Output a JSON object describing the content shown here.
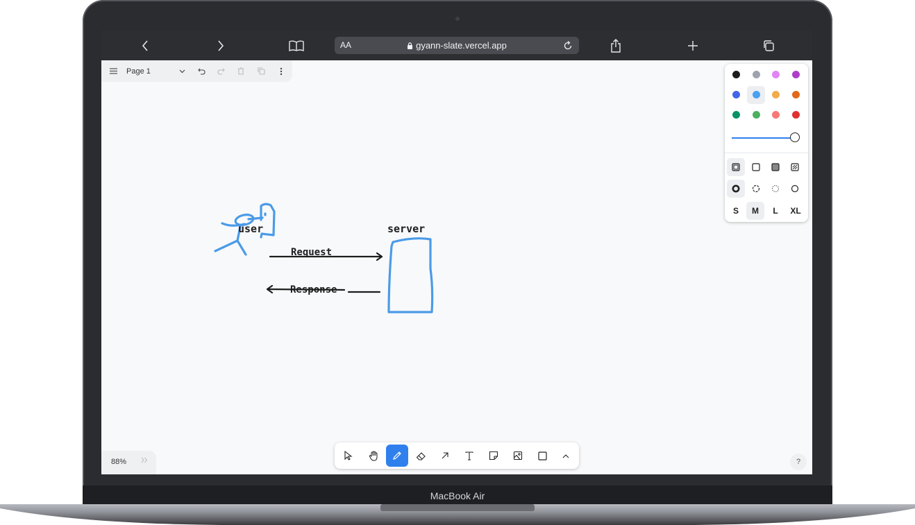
{
  "device": {
    "label": "MacBook Air"
  },
  "browser": {
    "back_icon": "chevron-left-icon",
    "forward_icon": "chevron-right-icon",
    "bookmarks_icon": "book-icon",
    "text_size_label": "AA",
    "url": "gyann-slate.vercel.app",
    "lock_icon": "lock-icon",
    "reload_icon": "reload-icon",
    "share_icon": "share-icon",
    "new_tab_icon": "plus-icon",
    "tabs_icon": "tabs-icon"
  },
  "page_menu": {
    "menu_icon": "hamburger-icon",
    "page_name": "Page 1",
    "dropdown_icon": "chevron-down-icon",
    "undo_icon": "undo-icon",
    "redo_icon": "redo-icon",
    "delete_icon": "trash-icon",
    "duplicate_icon": "duplicate-icon",
    "more_icon": "more-vertical-icon"
  },
  "canvas": {
    "labels": {
      "user": "user",
      "server": "server",
      "request": "Request",
      "response": "Response"
    },
    "stroke_color": "#4a9be8"
  },
  "style_panel": {
    "colors": [
      "#1d1d1d",
      "#9ea3ad",
      "#e085f4",
      "#ae3ec9",
      "#4465e9",
      "#4ba1f1",
      "#f1ac4b",
      "#e16919",
      "#099268",
      "#4cb05e",
      "#f87777",
      "#e03131"
    ],
    "selected_color_index": 5,
    "opacity": 1.0,
    "fill_options": [
      "fill-none-icon",
      "fill-semi-icon",
      "fill-solid-icon",
      "fill-pattern-icon"
    ],
    "dash_options": [
      "dash-draw-icon",
      "dash-dashed-icon",
      "dash-dotted-icon",
      "dash-solid-icon"
    ],
    "sizes": [
      "S",
      "M",
      "L",
      "XL"
    ],
    "selected_size": "M"
  },
  "toolbar": {
    "tools": [
      "select-icon",
      "hand-icon",
      "draw-icon",
      "eraser-icon",
      "arrow-icon",
      "text-icon",
      "note-icon",
      "image-icon",
      "rectangle-icon",
      "chevron-up-icon"
    ],
    "active_tool": "draw-icon"
  },
  "footer": {
    "zoom": "88%",
    "expand_icon": "double-chevron-right-icon",
    "help_label": "?"
  }
}
